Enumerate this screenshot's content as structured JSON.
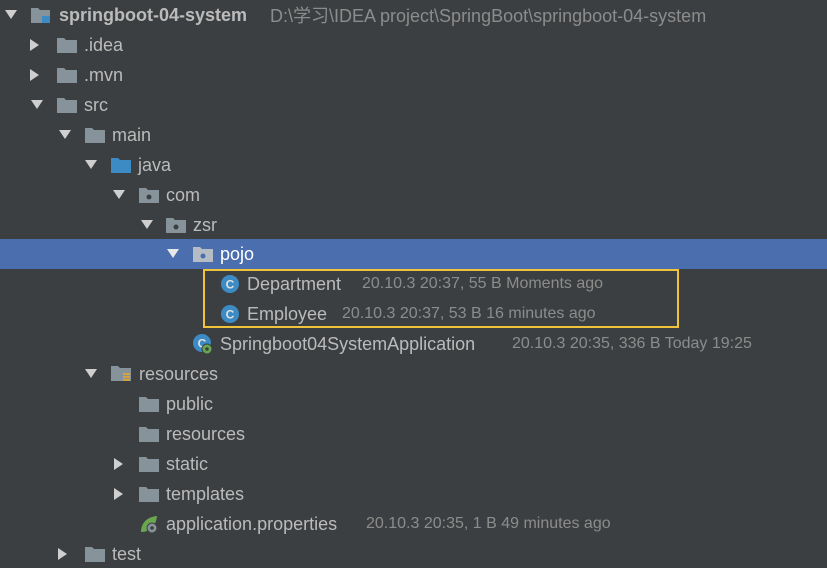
{
  "tree": {
    "root": {
      "label": "springboot-04-system",
      "path": "D:\\学习\\IDEA project\\SpringBoot\\springboot-04-system"
    },
    "nodes": [
      {
        "label": ".idea"
      },
      {
        "label": ".mvn"
      },
      {
        "label": "src"
      },
      {
        "label": "main"
      },
      {
        "label": "java"
      },
      {
        "label": "com"
      },
      {
        "label": "zsr"
      },
      {
        "label": "pojo"
      },
      {
        "label": "Department",
        "meta": "20.10.3 20:37, 55 B Moments ago"
      },
      {
        "label": "Employee",
        "meta": "20.10.3 20:37, 53 B 16 minutes ago"
      },
      {
        "label": "Springboot04SystemApplication",
        "meta": "20.10.3 20:35, 336 B Today 19:25"
      },
      {
        "label": "resources"
      },
      {
        "label": "public"
      },
      {
        "label": "resources"
      },
      {
        "label": "static"
      },
      {
        "label": "templates"
      },
      {
        "label": "application.properties",
        "meta": "20.10.3 20:35, 1 B 49 minutes ago"
      },
      {
        "label": "test"
      }
    ]
  },
  "colors": {
    "background": "#3c3f41",
    "selection": "#4b6eaf",
    "highlight": "#f0c43a",
    "folder": "#87939a",
    "source_folder": "#3d8bc4",
    "class_icon": "#3d8bc4",
    "spring": "#6aa84f"
  }
}
